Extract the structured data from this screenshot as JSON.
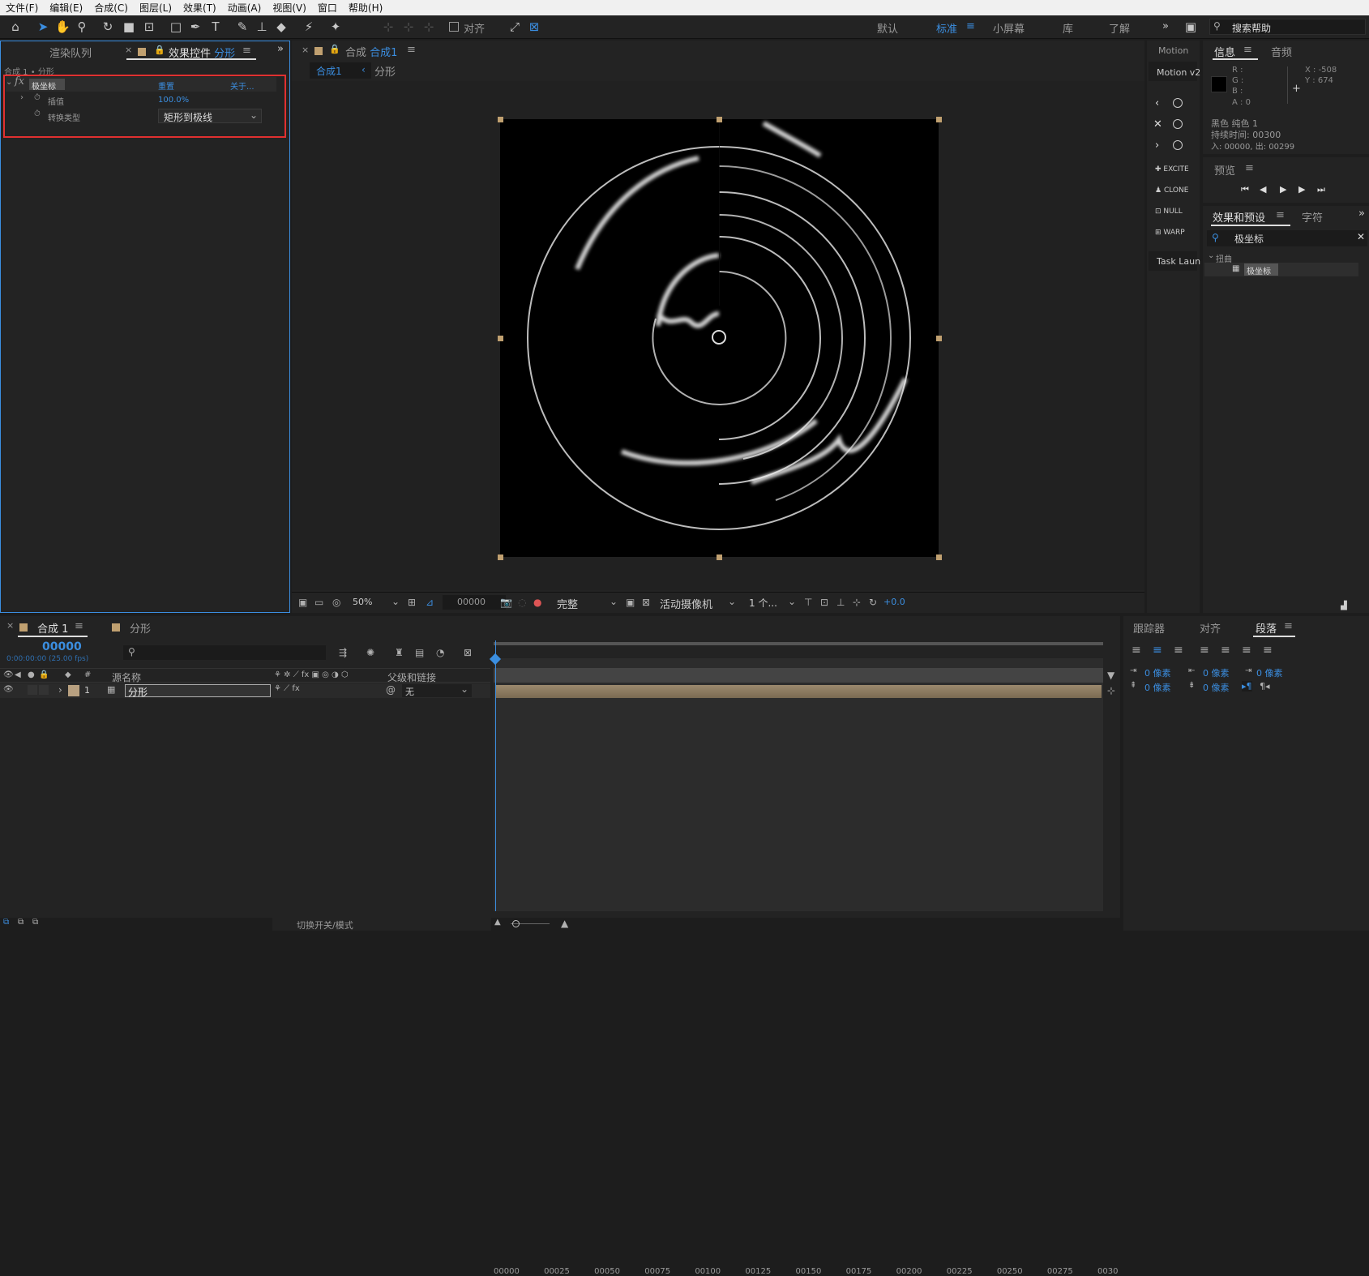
{
  "menu": [
    "文件(F)",
    "编辑(E)",
    "合成(C)",
    "图层(L)",
    "效果(T)",
    "动画(A)",
    "视图(V)",
    "窗口",
    "帮助(H)"
  ],
  "toolbar": {
    "snap_label": "对齐",
    "workspaces": [
      "默认",
      "标准",
      "小屏幕",
      "库",
      "了解"
    ],
    "active_workspace": "标准",
    "search_placeholder": "搜索帮助"
  },
  "left_panel": {
    "tabs": [
      "渲染队列",
      "效果控件 分形"
    ],
    "tab_render": "渲染队列",
    "tab_effects_prefix": "效果控件",
    "tab_effects_layer": "分形",
    "breadcrumb": "合成 1 • 分形",
    "effect_name": "极坐标",
    "reset": "重置",
    "about": "关于...",
    "prop1_label": "插值",
    "prop1_value": "100.0%",
    "prop2_label": "转换类型",
    "prop2_value": "矩形到极线"
  },
  "comp_panel": {
    "tab_prefix": "合成",
    "tab_name": "合成1",
    "crumb_active": "合成1",
    "crumb_layer": "分形",
    "zoom": "50%",
    "timecode": "00000",
    "quality": "完整",
    "camera": "活动摄像机",
    "views": "1 个...",
    "exposure": "+0.0"
  },
  "motion_panel": {
    "title": "Motion",
    "subtitle": "Motion v2",
    "buttons": [
      "EXCITE",
      "CLONE",
      "NULL",
      "WARP"
    ],
    "task": "Task Laun"
  },
  "info_panel": {
    "tab_info": "信息",
    "tab_audio": "音频",
    "r": "R :",
    "g": "G :",
    "b": "B :",
    "a": "A : 0",
    "x": "X : -508",
    "y": "Y : 674",
    "layer_name": "黑色 纯色 1",
    "duration": "持续时间: 00300",
    "inout": "入: 00000, 出: 00299"
  },
  "preview_panel": {
    "title": "预览"
  },
  "effects_presets": {
    "tab": "效果和预设",
    "tab2": "字符",
    "search": "极坐标",
    "category": "扭曲",
    "item": "极坐标"
  },
  "timeline": {
    "tab": "合成 1",
    "tab2": "分形",
    "timecode": "00000",
    "timecode_sub": "0:00:00:00 (25.00 fps)",
    "col_source": "源名称",
    "col_parent": "父级和链接",
    "layer_num": "1",
    "layer_name": "分形",
    "parent_value": "无",
    "ruler": [
      "00000",
      "00025",
      "00050",
      "00075",
      "00100",
      "00125",
      "00150",
      "00175",
      "00200",
      "00225",
      "00250",
      "00275",
      "0030"
    ],
    "footer": "切换开关/模式"
  },
  "paragraph_panel": {
    "tabs": [
      "跟踪器",
      "对齐",
      "段落"
    ],
    "tab_tracker": "跟踪器",
    "tab_align": "对齐",
    "tab_para": "段落",
    "indent1": "0 像素",
    "indent2": "0 像素",
    "indent3": "0 像素",
    "space1": "0 像素",
    "space2": "0 像素"
  },
  "colors": {
    "accent": "#3b8ee0",
    "highlight_box": "#e03030",
    "layer_color": "#b8a080"
  }
}
